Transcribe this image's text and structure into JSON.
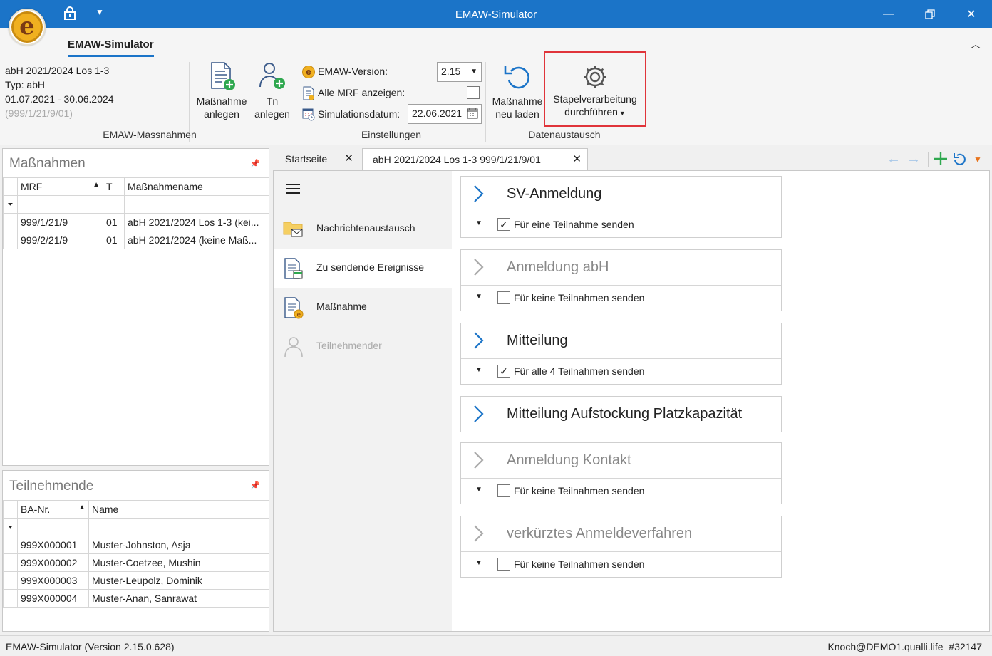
{
  "window": {
    "title": "EMAW-Simulator"
  },
  "ribbon": {
    "tab_label": "EMAW-Simulator",
    "info": {
      "line1": "abH 2021/2024 Los 1-3",
      "line2": "Typ: abH",
      "line3": "01.07.2021 - 30.06.2024",
      "line4": "(999/1/21/9/01)"
    },
    "group_massnahmen": {
      "label": "EMAW-Massnahmen",
      "btn_anlegen": {
        "line1": "Maßnahme",
        "line2": "anlegen"
      },
      "btn_tn": {
        "line1": "Tn",
        "line2": "anlegen"
      }
    },
    "group_einstellungen": {
      "label": "Einstellungen",
      "version_label": "EMAW-Version:",
      "version_value": "2.15",
      "mrf_label": "Alle MRF anzeigen:",
      "mrf_checked": false,
      "simdate_label": "Simulationsdatum:",
      "simdate_value": "22.06.2021"
    },
    "group_datenaustausch": {
      "label": "Datenaustausch",
      "btn_reload": {
        "line1": "Maßnahme",
        "line2": "neu laden"
      },
      "btn_batch": {
        "line1": "Stapelverarbeitung",
        "line2": "durchführen"
      }
    }
  },
  "massnahmen_panel": {
    "title": "Maßnahmen",
    "columns": [
      "MRF",
      "T",
      "Maßnahmename"
    ],
    "rows": [
      {
        "mrf": "999/1/21/9",
        "t": "01",
        "name": "abH 2021/2024 Los 1-3 (kei..."
      },
      {
        "mrf": "999/2/21/9",
        "t": "01",
        "name": "abH 2021/2024 (keine Maß..."
      }
    ]
  },
  "teilnehmende_panel": {
    "title": "Teilnehmende",
    "columns": [
      "BA-Nr.",
      "Name"
    ],
    "rows": [
      {
        "ba": "999X000001",
        "name": "Muster-Johnston, Asja"
      },
      {
        "ba": "999X000002",
        "name": "Muster-Coetzee, Mushin"
      },
      {
        "ba": "999X000003",
        "name": "Muster-Leupolz, Dominik"
      },
      {
        "ba": "999X000004",
        "name": "Muster-Anan, Sanrawat"
      }
    ]
  },
  "tabs": [
    {
      "label": "Startseite"
    },
    {
      "label": "abH 2021/2024 Los 1-3 999/1/21/9/01"
    }
  ],
  "nav": [
    {
      "label": "Nachrichtenaustausch",
      "icon": "mail-folder-icon"
    },
    {
      "label": "Zu sendende Ereignisse",
      "icon": "document-list-icon"
    },
    {
      "label": "Maßnahme",
      "icon": "document-e-icon"
    },
    {
      "label": "Teilnehmender",
      "icon": "person-icon"
    }
  ],
  "events": [
    {
      "name": "SV-Anmeldung",
      "body": "Für eine Teilnahme senden",
      "checked": true,
      "active": true
    },
    {
      "name": "Anmeldung abH",
      "body": "Für keine Teilnahmen senden",
      "checked": false,
      "active": false
    },
    {
      "name": "Mitteilung",
      "body": "Für alle 4 Teilnahmen senden",
      "checked": true,
      "active": true
    },
    {
      "name": "Mitteilung Aufstockung Platzkapazität",
      "body": "",
      "checked": false,
      "active": true
    },
    {
      "name": "Anmeldung Kontakt",
      "body": "Für keine Teilnahmen senden",
      "checked": false,
      "active": false
    },
    {
      "name": "verkürztes Anmeldeverfahren",
      "body": "Für keine Teilnahmen senden",
      "checked": false,
      "active": false
    }
  ],
  "status": {
    "left": "EMAW-Simulator (Version 2.15.0.628)",
    "right": "Knoch@DEMO1.qualli.life  #32147"
  },
  "colors": {
    "accent": "#1b74c8",
    "highlight_border": "#e0343a",
    "add_green": "#2fa84f",
    "orange": "#e8731c"
  }
}
